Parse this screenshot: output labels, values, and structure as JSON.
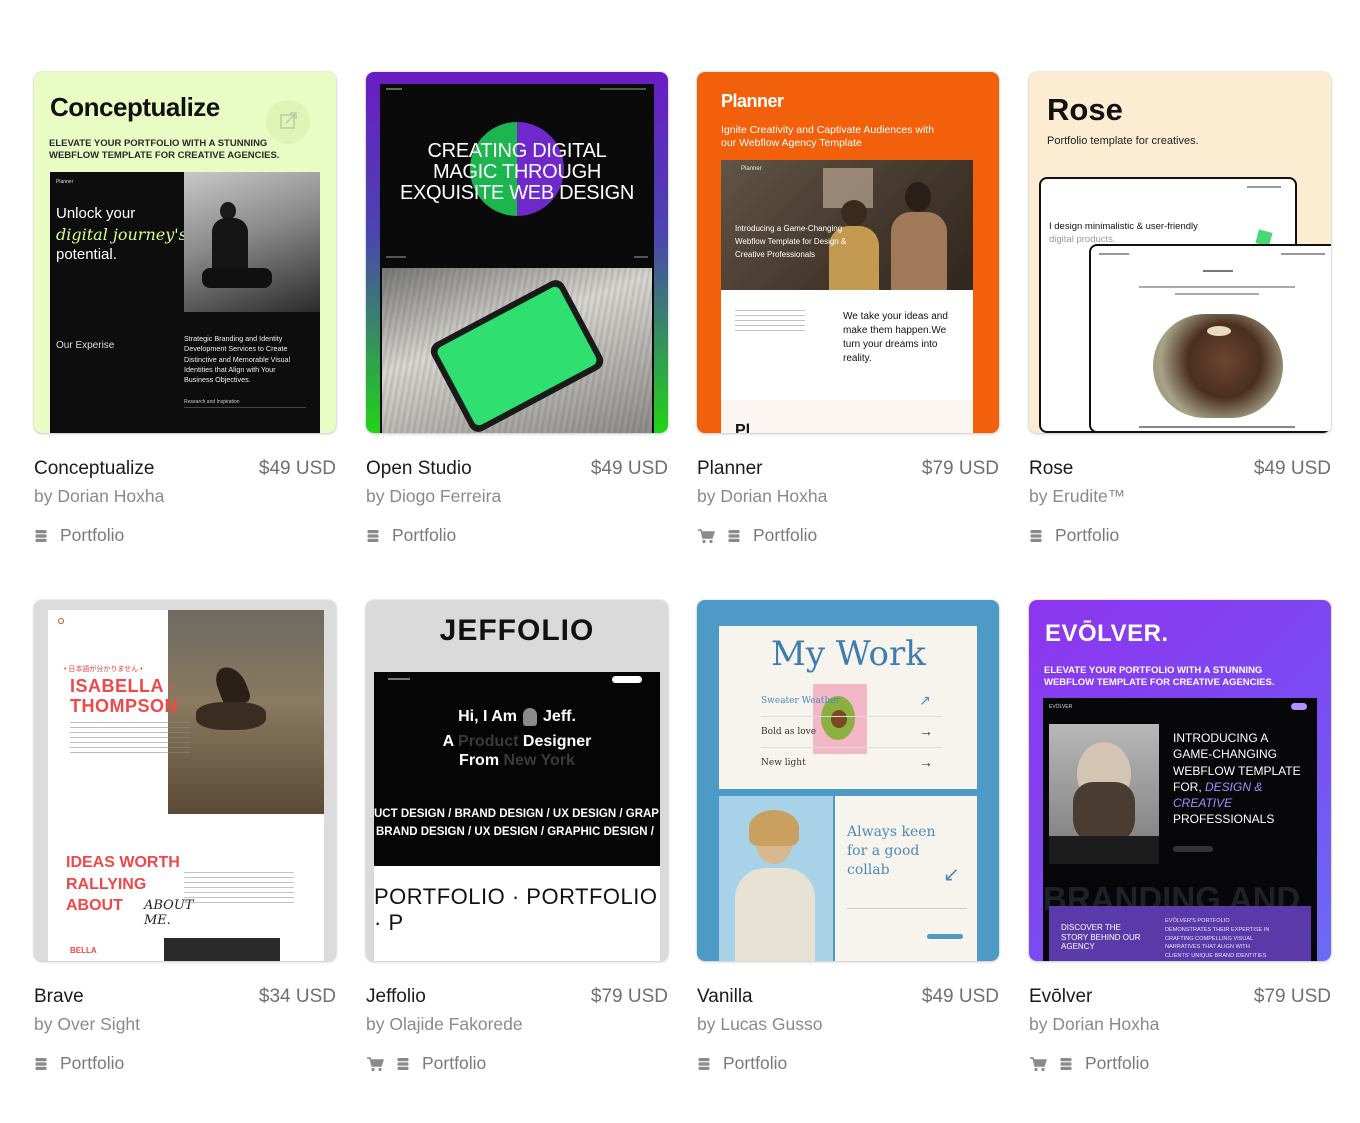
{
  "templates": [
    {
      "name": "Conceptualize",
      "price": "$49 USD",
      "author": "by Dorian Hoxha",
      "category": "Portfolio",
      "has_cart": false,
      "preview": {
        "title": "Conceptualize",
        "tagline": "ELEVATE YOUR PORTFOLIO WITH A STUNNING\nWEBFLOW TEMPLATE FOR CREATIVE AGENCIES.",
        "nav_logo": "Planner",
        "hero_line1": "Unlock your",
        "hero_line2": "digital journey's",
        "hero_line3": "potential.",
        "section_label": "Our Experise",
        "section_text": "Strategic Branding and Identity\nDevelopment Services to Create\nDistinctive and Memorable Visual\nIdentities that Align with Your\nBusiness Objectives.",
        "sub_label": "Research and Inspiration"
      }
    },
    {
      "name": "Open Studio",
      "price": "$49 USD",
      "author": "by Diogo Ferreira",
      "category": "Portfolio",
      "has_cart": false,
      "preview": {
        "headline": "CREATING DIGITAL\nMAGIC THROUGH\nEXQUISITE WEB DESIGN"
      }
    },
    {
      "name": "Planner",
      "price": "$79 USD",
      "author": "by Dorian Hoxha",
      "category": "Portfolio",
      "has_cart": true,
      "preview": {
        "logo": "Planner",
        "tagline": "Ignite Creativity and Captivate Audiences with\nour Webflow Agency Template",
        "nav_logo": "Planner",
        "intro": "Introducing a Game-Changing\nWebflow Template for Design &\nCreative Professionals",
        "quote": "We take your ideas and\nmake them happen.We\nturn your dreams into\nreality.",
        "bottom": "Pl"
      }
    },
    {
      "name": "Rose",
      "price": "$49 USD",
      "author": "by Erudite™",
      "category": "Portfolio",
      "has_cart": false,
      "preview": {
        "title": "Rose",
        "subtitle": "Portfolio template for creatives.",
        "mock_text1": "I design minimalistic & user-friendly",
        "mock_text2": "digital products."
      }
    },
    {
      "name": "Brave",
      "price": "$34 USD",
      "author": "by Over Sight",
      "category": "Portfolio",
      "has_cart": false,
      "preview": {
        "kana": "• 日本語が分かりません •",
        "name_line1": "ISABELLA -",
        "name_line2": "THOMPSON",
        "ideas": "IDEAS WORTH\nRALLYING\nABOUT",
        "about_script": "ABOUT\nME.",
        "bella": "BELLA"
      }
    },
    {
      "name": "Jeffolio",
      "price": "$79 USD",
      "author": "by Olajide Fakorede",
      "category": "Portfolio",
      "has_cart": true,
      "preview": {
        "title": "JEFFOLIO",
        "hi": "Hi, I Am",
        "jeff": "Jeff.",
        "line2a": "A ",
        "line2b": "Product",
        "line2c": " Designer",
        "line3a": "From ",
        "line3b": "New York",
        "ticker1": "UCT DESIGN / BRAND DESIGN / UX DESIGN / GRAP",
        "ticker2": "BRAND DESIGN / UX DESIGN / GRAPHIC DESIGN /",
        "marquee": "PORTFOLIO · PORTFOLIO · P"
      }
    },
    {
      "name": "Vanilla",
      "price": "$49 USD",
      "author": "by Lucas Gusso",
      "category": "Portfolio",
      "has_cart": false,
      "preview": {
        "title": "My Work",
        "items": [
          "Sweater Weather",
          "Bold as love",
          "New light"
        ],
        "collab": "Always keen\nfor a good\ncollab"
      }
    },
    {
      "name": "Evōlver",
      "price": "$79 USD",
      "author": "by Dorian Hoxha",
      "category": "Portfolio",
      "has_cart": true,
      "preview": {
        "logo": "EVŌLVER.",
        "tagline": "ELEVATE YOUR PORTFOLIO WITH A STUNNING\nWEBFLOW TEMPLATE FOR CREATIVE AGENCIES.",
        "nav_logo": "EVŌLVER",
        "intro_a": "INTRODUCING A\nGAME-CHANGING\nWEBFLOW TEMPLATE\nFOR, ",
        "intro_b": "DESIGN &\nCREATIVE",
        "intro_c": "\nPROFESSIONALS",
        "branding": "BRANDING AND",
        "discover": "DISCOVER THE\nSTORY BEHIND OUR\nAGENCY",
        "small": "EVŌLVER'S PORTFOLIO\nDEMONSTRATES THEIR EXPERTISE IN\nCRAFTING COMPELLING VISUAL\nNARRATIVES THAT ALIGN WITH\nCLIENTS' UNIQUE BRAND IDENTITIES"
      }
    }
  ],
  "colors": {
    "conceptualize_bg": "#e8fcc4",
    "openstudio_gradient": [
      "#6a1cc4",
      "#22d416"
    ],
    "planner_bg": "#f2600c",
    "rose_bg": "#fbecd2",
    "vanilla_bg": "#4d9ac6",
    "evolver_bg": "#8d35ee"
  }
}
